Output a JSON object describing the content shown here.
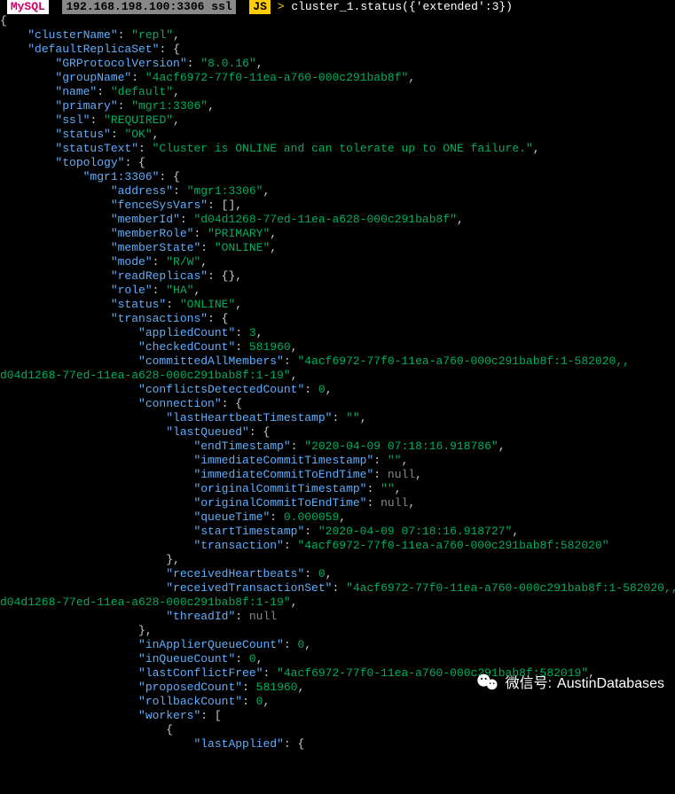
{
  "prompt": {
    "engine": "MySQL",
    "host": "192.168.198.100:3306 ssl",
    "mode": "JS",
    "command": "cluster_1.status({'extended':3})"
  },
  "json": {
    "clusterName": "repl",
    "defaultReplicaSet": {
      "GRProtocolVersion": "8.0.16",
      "groupName": "4acf6972-77f0-11ea-a760-000c291bab8f",
      "name": "default",
      "primary": "mgr1:3306",
      "ssl": "REQUIRED",
      "status": "OK",
      "statusText": "Cluster is ONLINE and can tolerate up to ONE failure.",
      "topology": {
        "mgr1:3306": {
          "address": "mgr1:3306",
          "fenceSysVars": "__EMPTY_ARRAY__",
          "memberId": "d04d1268-77ed-11ea-a628-000c291bab8f",
          "memberRole": "PRIMARY",
          "memberState": "ONLINE",
          "mode": "R/W",
          "readReplicas": "__EMPTY_OBJECT__",
          "role": "HA",
          "status": "ONLINE",
          "transactions": {
            "appliedCount": 3,
            "checkedCount": 581960,
            "committedAllMembers": "4acf6972-77f0-11ea-a760-000c291bab8f:1-582020,\nd04d1268-77ed-11ea-a628-000c291bab8f:1-19",
            "conflictsDetectedCount": 0,
            "connection": {
              "lastHeartbeatTimestamp": "",
              "lastQueued": {
                "endTimestamp": "2020-04-09 07:18:16.918786",
                "immediateCommitTimestamp": "",
                "immediateCommitToEndTime": null,
                "originalCommitTimestamp": "",
                "originalCommitToEndTime": null,
                "queueTime": 5.9e-05,
                "startTimestamp": "2020-04-09 07:18:16.918727",
                "transaction": "4acf6972-77f0-11ea-a760-000c291bab8f:582020"
              },
              "receivedHeartbeats": 0,
              "receivedTransactionSet": "4acf6972-77f0-11ea-a760-000c291bab8f:1-582020,\nd04d1268-77ed-11ea-a628-000c291bab8f:1-19",
              "threadId": null
            },
            "inApplierQueueCount": 0,
            "inQueueCount": 0,
            "lastConflictFree": "4acf6972-77f0-11ea-a760-000c291bab8f:582019",
            "proposedCount": 581960,
            "rollbackCount": 0,
            "workers": [
              {
                "lastApplied": "__TRUNCATED__"
              }
            ]
          }
        }
      }
    }
  },
  "indent_unit": "    ",
  "watermark": {
    "label": "微信号:",
    "value": "AustinDatabases"
  }
}
